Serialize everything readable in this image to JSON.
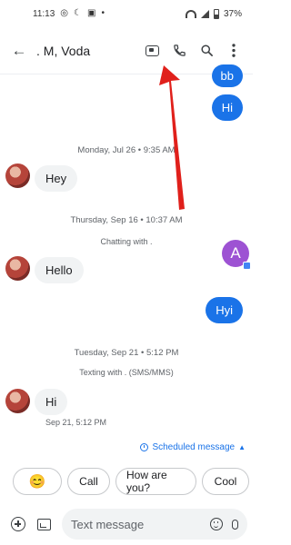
{
  "status_bar": {
    "time": "11:13",
    "battery": "37%"
  },
  "app_bar": {
    "title": ". M, Voda"
  },
  "conversation": {
    "outgoing_top": [
      "bb",
      "Hi"
    ],
    "day1": "Monday, Jul 26 • 9:35 AM",
    "msg1": "Hey",
    "day2": "Thursday, Sep 16 • 10:37 AM",
    "note2": "Chatting with .",
    "msg2": "Hello",
    "outgoing_hyi": "Hyi",
    "contact_initial": "A",
    "day3": "Tuesday, Sep 21 • 5:12 PM",
    "note3": "Texting with . (SMS/MMS)",
    "msg3": "Hi",
    "msg3_time": "Sep 21, 5:12 PM"
  },
  "scheduled": {
    "label": "Scheduled message"
  },
  "smart_replies": [
    "😊",
    "Call",
    "How are you?",
    "Cool"
  ],
  "compose": {
    "placeholder": "Text message"
  },
  "colors": {
    "accent": "#1a73e8",
    "arrow": "#e0201b",
    "contact_avatar": "#9d52d3"
  }
}
